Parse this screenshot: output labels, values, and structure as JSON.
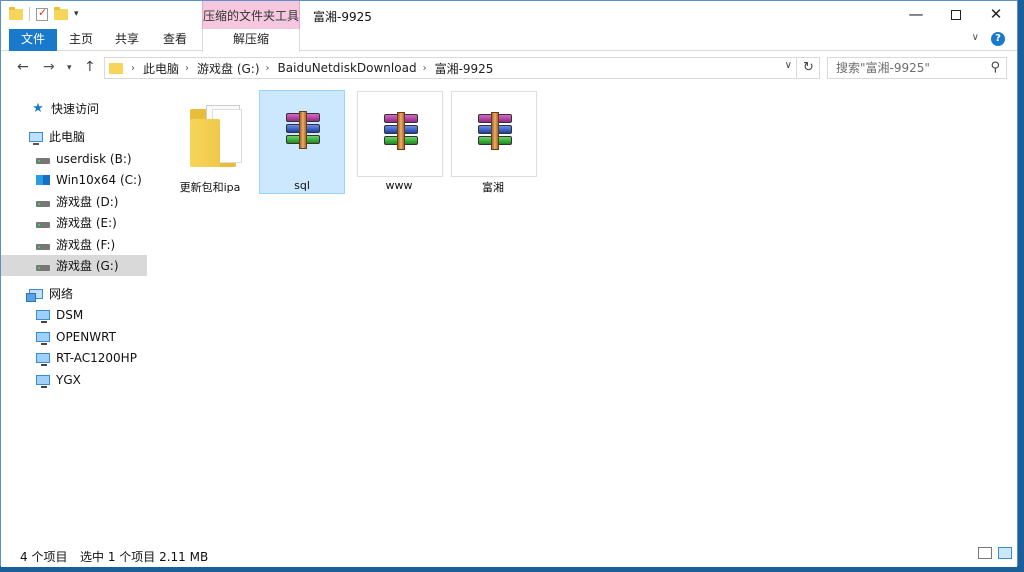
{
  "window": {
    "title": "富湘-9925",
    "context_tab_group": "压缩的文件夹工具",
    "controls": {
      "minimize": "—",
      "maximize": "",
      "close": "✕"
    }
  },
  "ribbon": {
    "tabs": [
      "文件",
      "主页",
      "共享",
      "查看",
      "解压缩"
    ],
    "expand_glyph": "∨",
    "help_glyph": "?"
  },
  "address": {
    "path": [
      "此电脑",
      "游戏盘 (G:)",
      "BaiduNetdiskDownload",
      "富湘-9925"
    ],
    "search_placeholder": "搜索\"富湘-9925\""
  },
  "nav": {
    "quick_access": "快速访问",
    "this_pc": "此电脑",
    "drives": [
      "userdisk (B:)",
      "Win10x64 (C:)",
      "游戏盘 (D:)",
      "游戏盘 (E:)",
      "游戏盘 (F:)",
      "游戏盘 (G:)"
    ],
    "selected_drive": "游戏盘 (G:)",
    "network": "网络",
    "network_items": [
      "DSM",
      "OPENWRT",
      "RT-AC1200HP",
      "YGX"
    ]
  },
  "files": [
    {
      "name": "更新包和ipa",
      "type": "folder",
      "icon": "folder-icon"
    },
    {
      "name": "sql",
      "type": "rar",
      "icon": "winrar-archive-icon",
      "selected": true
    },
    {
      "name": "www",
      "type": "rar",
      "icon": "winrar-archive-icon"
    },
    {
      "name": "富湘",
      "type": "rar",
      "icon": "winrar-archive-icon"
    }
  ],
  "status": {
    "item_count": "4 个项目",
    "selection": "选中 1 个项目  2.11 MB"
  },
  "colors": {
    "accent": "#1979ca",
    "context_tab": "#f6c8e0",
    "selection": "#cce8ff"
  }
}
